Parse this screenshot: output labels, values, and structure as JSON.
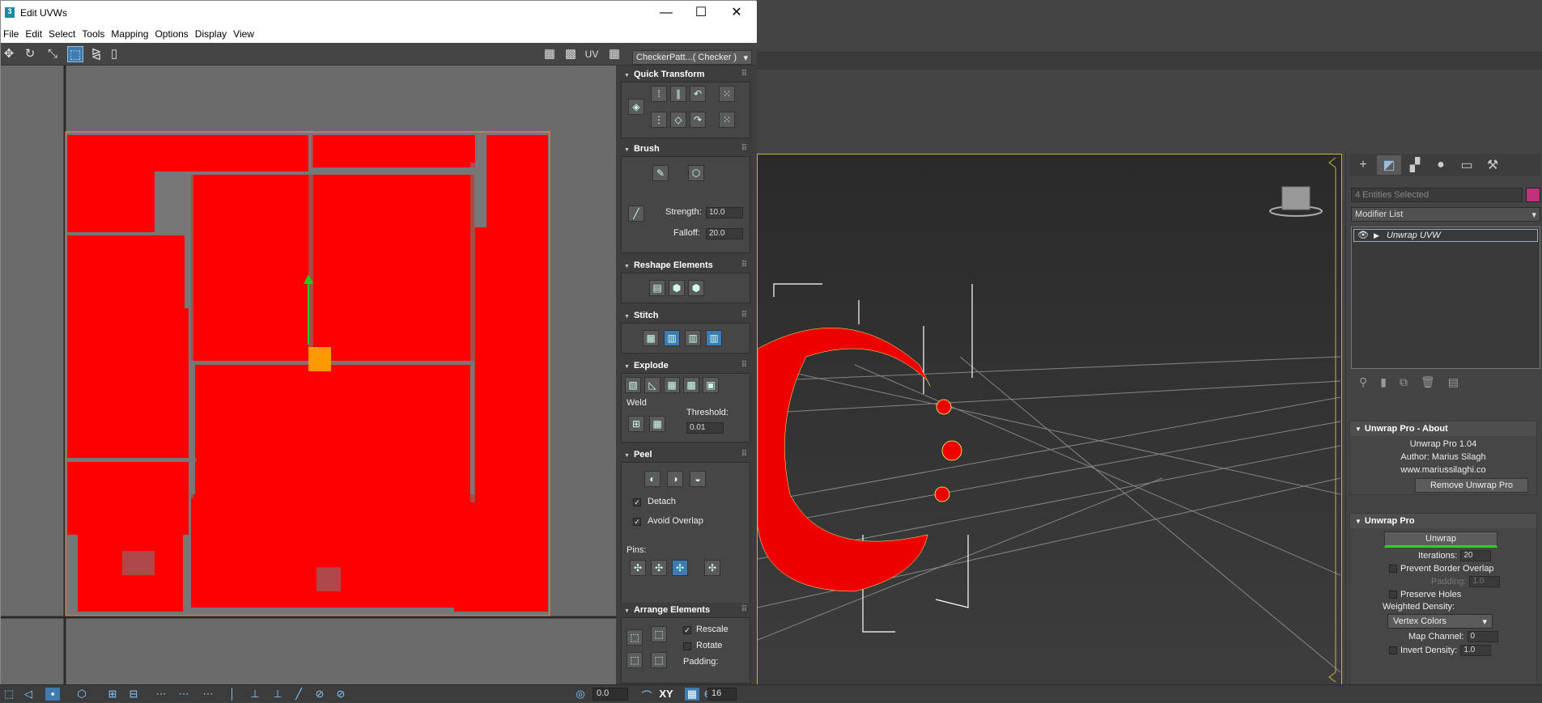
{
  "window": {
    "title": "Edit UVWs",
    "icon_label": "3",
    "minimize": "—",
    "maximize": "☐",
    "close": "✕"
  },
  "menu": [
    "File",
    "Edit",
    "Select",
    "Tools",
    "Mapping",
    "Options",
    "Display",
    "View"
  ],
  "toolbar": {
    "uv_label": "UV",
    "texture_dropdown": "CheckerPatt...( Checker )"
  },
  "side_panel": {
    "quick_transform": {
      "title": "Quick Transform"
    },
    "brush": {
      "title": "Brush",
      "strength_label": "Strength:",
      "strength_value": "10.0",
      "falloff_label": "Falloff:",
      "falloff_value": "20.0"
    },
    "reshape": {
      "title": "Reshape Elements"
    },
    "stitch": {
      "title": "Stitch"
    },
    "explode": {
      "title": "Explode",
      "weld_label": "Weld",
      "threshold_label": "Threshold:",
      "threshold_value": "0.01"
    },
    "peel": {
      "title": "Peel",
      "detach_label": "Detach",
      "avoid_overlap_label": "Avoid Overlap",
      "pins_label": "Pins:"
    },
    "arrange": {
      "title": "Arrange Elements",
      "rescale_label": "Rescale",
      "rotate_label": "Rotate",
      "padding_label": "Padding:"
    }
  },
  "command_panel": {
    "selection_name": "4 Entities Selected",
    "modifier_list": "Modifier List",
    "stack_item": "Unwrap UVW",
    "about": {
      "title": "Unwrap Pro - About",
      "version": "Unwrap Pro 1.04",
      "author": "Author: Marius Silagh",
      "website": "www.mariussilaghi.co",
      "remove_button": "Remove Unwrap Pro"
    },
    "unwrap_pro": {
      "title": "Unwrap Pro",
      "unwrap_button": "Unwrap",
      "iterations_label": "Iterations:",
      "iterations_value": "20",
      "prevent_border_label": "Prevent Border Overlap",
      "padding_label": "Padding:",
      "padding_value": "1.0",
      "preserve_holes_label": "Preserve Holes",
      "weighted_density_label": "Weighted Density:",
      "density_source": "Vertex Colors",
      "map_channel_label": "Map Channel:",
      "map_channel_value": "0",
      "invert_density_label": "Invert Density:",
      "invert_density_value": "1.0"
    }
  },
  "bottom_bar": {
    "rotation_value": "0.0",
    "axis_label": "XY",
    "grid_value": "16"
  },
  "colors": {
    "uv_fill": "#ff0000",
    "viewport_border": "#c8b432",
    "accent_blue": "#3d7bb0"
  }
}
